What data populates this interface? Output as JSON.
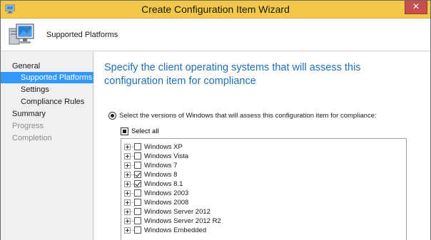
{
  "window": {
    "title": "Create Configuration Item Wizard",
    "close_glyph": "✕"
  },
  "header": {
    "title": "Supported Platforms"
  },
  "nav": {
    "items": [
      {
        "label": "General",
        "level": "top",
        "state": "normal"
      },
      {
        "label": "Supported Platforms",
        "level": "sub",
        "state": "selected"
      },
      {
        "label": "Settings",
        "level": "sub",
        "state": "normal"
      },
      {
        "label": "Compliance Rules",
        "level": "sub",
        "state": "normal"
      },
      {
        "label": "Summary",
        "level": "top",
        "state": "normal"
      },
      {
        "label": "Progress",
        "level": "top",
        "state": "disabled"
      },
      {
        "label": "Completion",
        "level": "top",
        "state": "disabled"
      }
    ]
  },
  "main": {
    "heading": "Specify the client operating systems that will assess this configuration item for compliance",
    "radio_label": "Select the versions of Windows that will assess this configuration item for compliance:",
    "select_all_label": "Select all",
    "platforms": [
      {
        "label": "Windows XP",
        "checked": false
      },
      {
        "label": "Windows Vista",
        "checked": false
      },
      {
        "label": "Windows 7",
        "checked": false
      },
      {
        "label": "Windows 8",
        "checked": true
      },
      {
        "label": "Windows 8.1",
        "checked": true
      },
      {
        "label": "Windows 2003",
        "checked": false
      },
      {
        "label": "Windows 2008",
        "checked": false
      },
      {
        "label": "Windows Server 2012",
        "checked": false
      },
      {
        "label": "Windows Server 2012 R2",
        "checked": false
      },
      {
        "label": "Windows Embedded",
        "checked": false
      }
    ]
  },
  "colors": {
    "titlebar": "#f3c84a",
    "heading": "#1f6fb8",
    "nav_selected": "#3399ff",
    "close_button": "#c7504f"
  }
}
